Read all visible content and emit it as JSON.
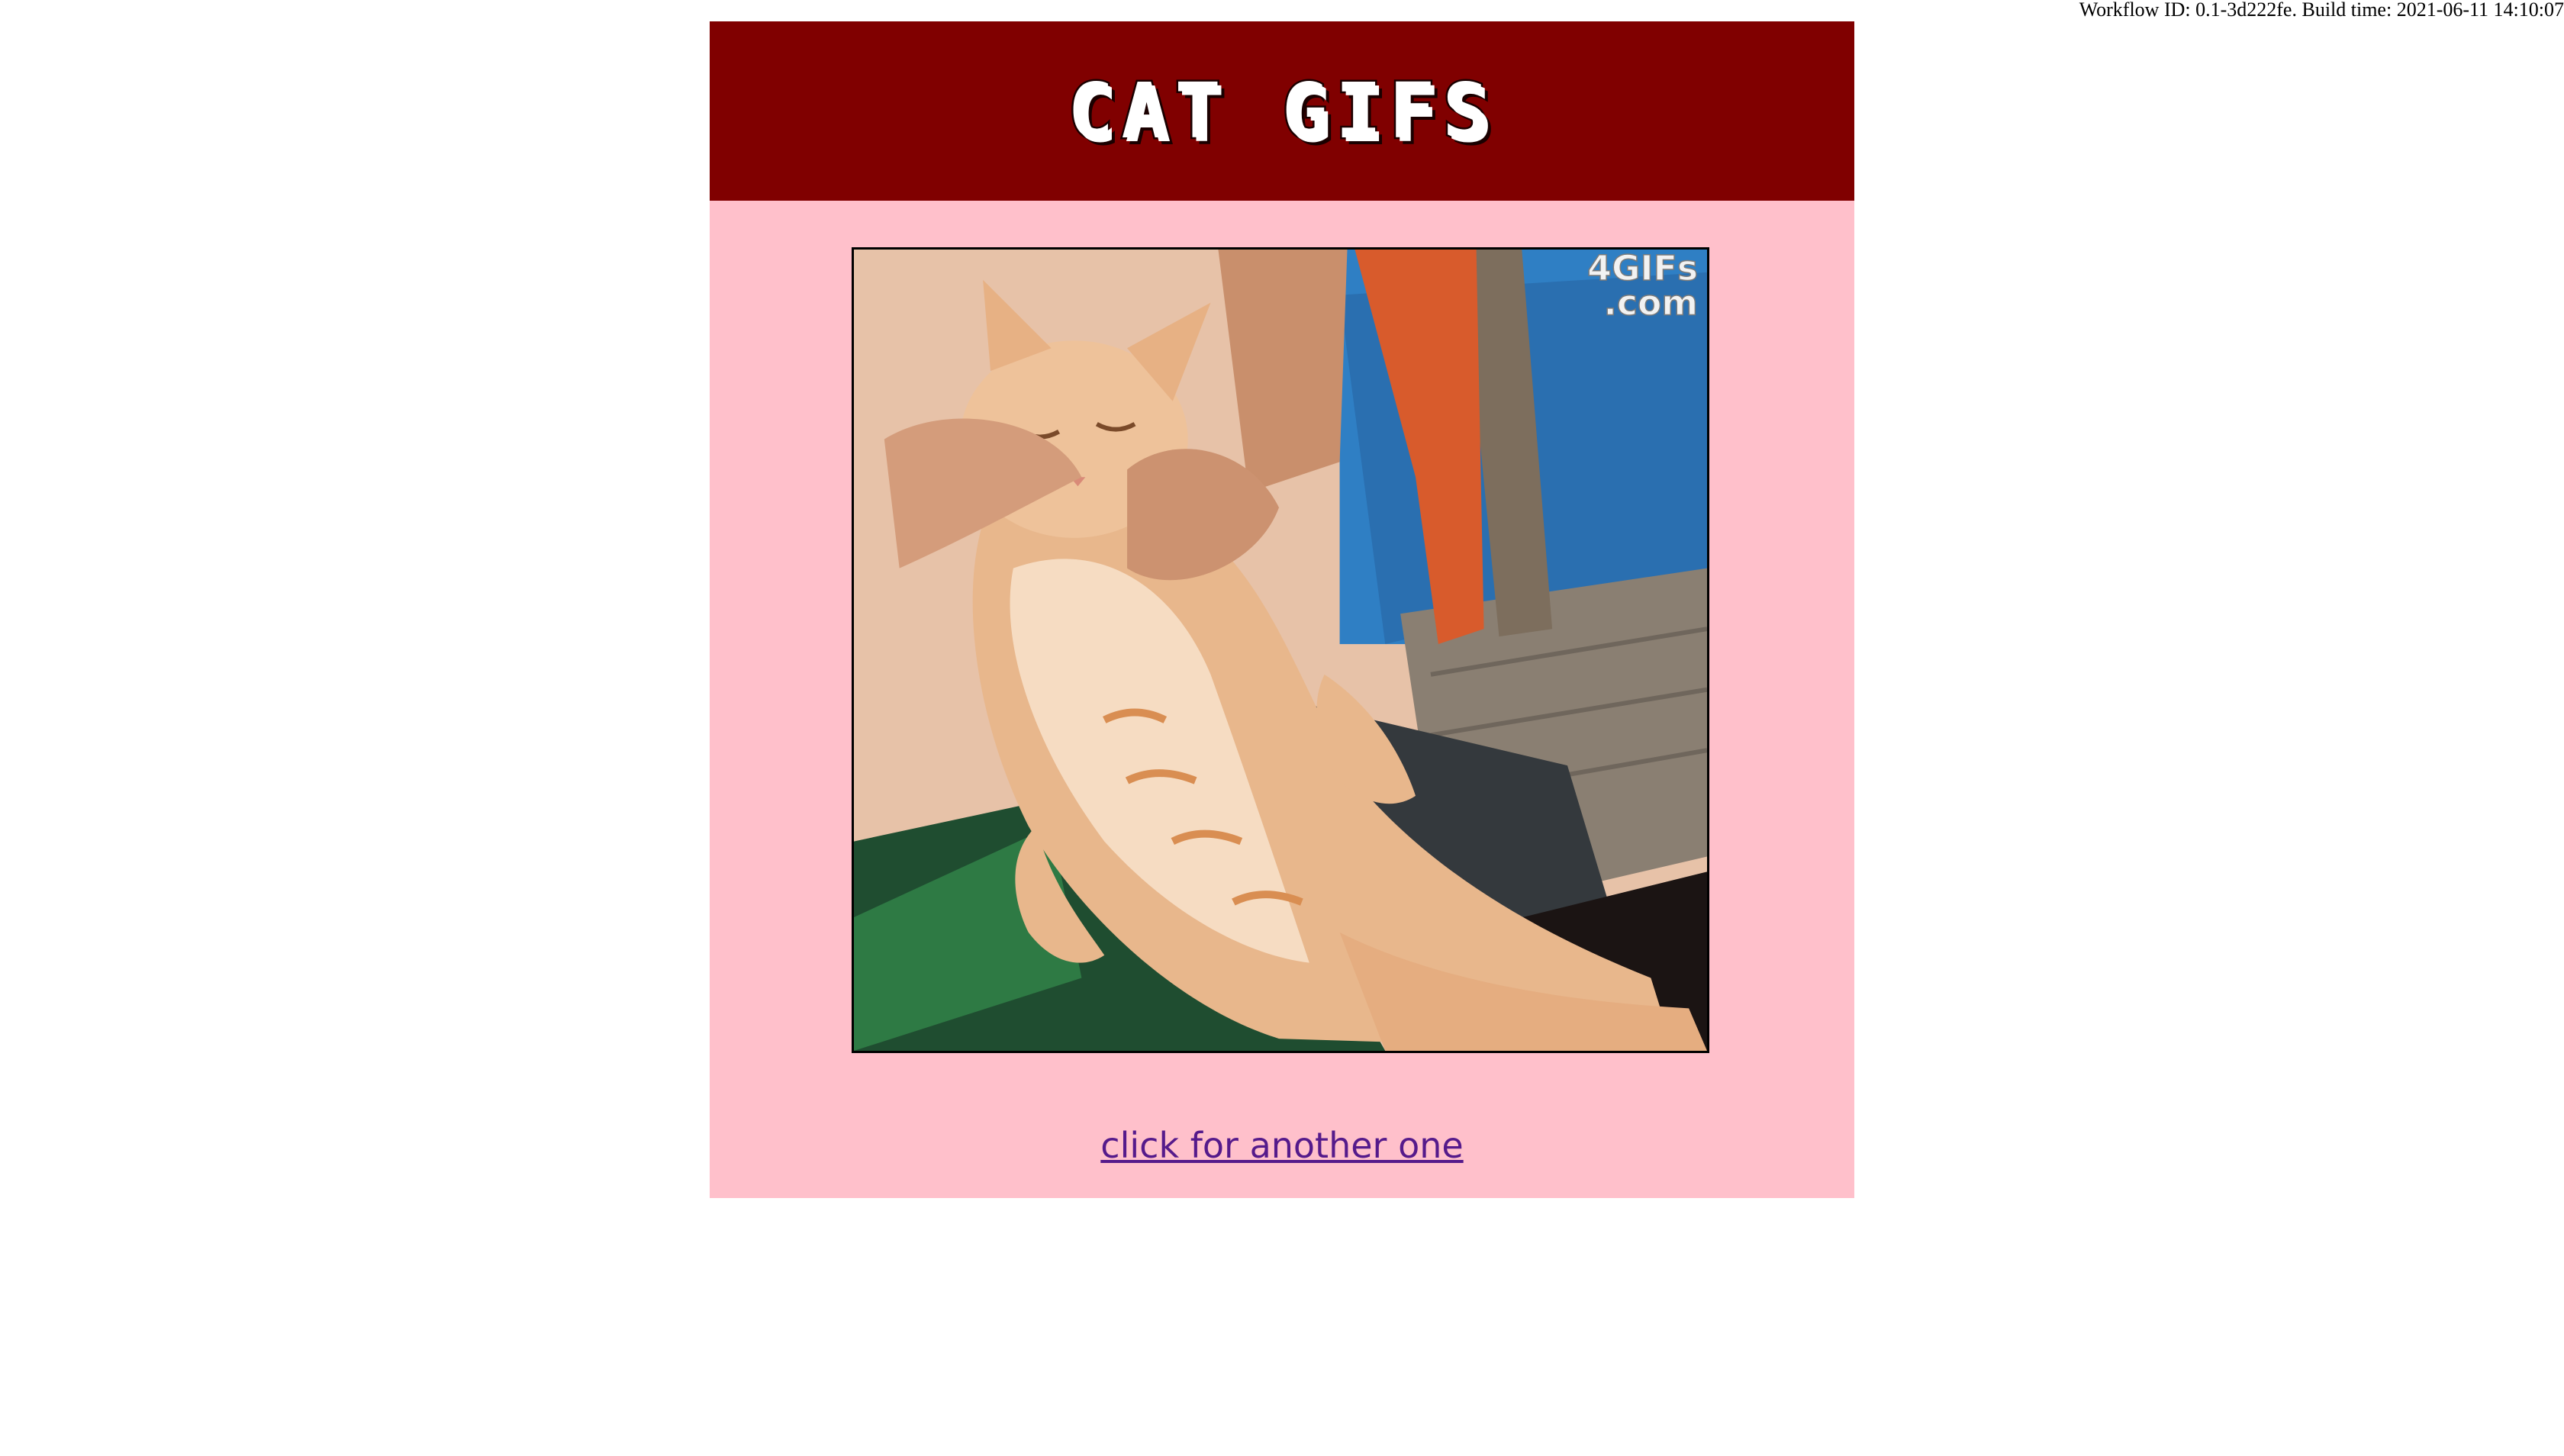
{
  "build_info": {
    "text": "Workflow ID: 0.1-3d222fe. Build time: 2021-06-11 14:10:07"
  },
  "header": {
    "title": "CAT GIFS"
  },
  "gif": {
    "watermark_line1": "4GIFs",
    "watermark_line2": ".com"
  },
  "link": {
    "label": "click for another one"
  },
  "colors": {
    "header_bg": "#800000",
    "card_bg": "#ffc0cb",
    "link": "#551a8b"
  }
}
